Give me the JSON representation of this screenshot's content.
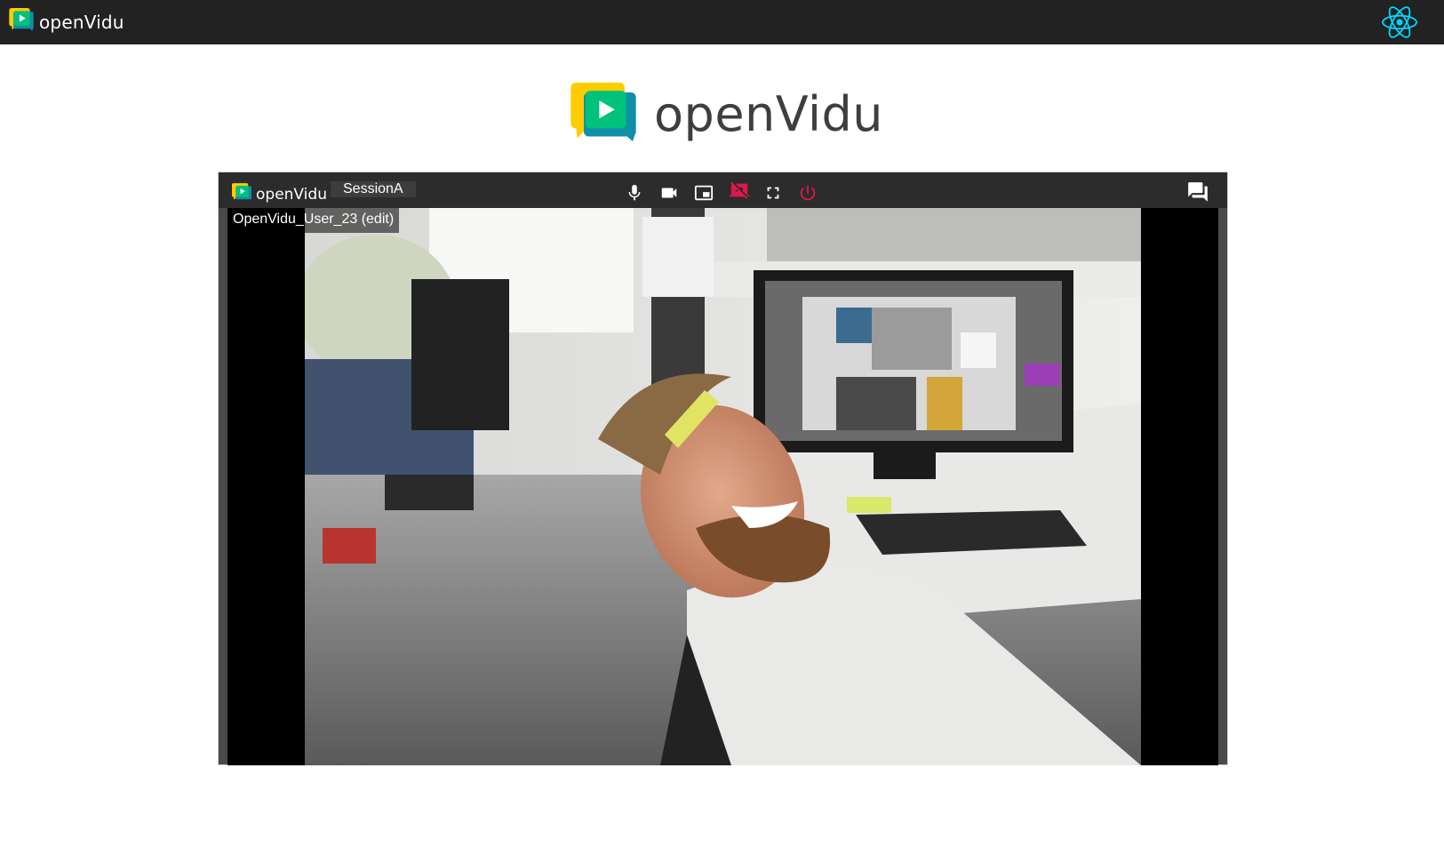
{
  "navbar": {
    "brand_text": "openVidu"
  },
  "hero": {
    "brand_text": "openVidu"
  },
  "session": {
    "toolbar_brand_text": "openVidu",
    "session_name": "SessionA",
    "nickname": "OpenVidu_User_23 (edit)",
    "controls": [
      {
        "name": "microphone",
        "icon": "mic-icon",
        "state": "on"
      },
      {
        "name": "camera",
        "icon": "videocam-icon",
        "state": "on"
      },
      {
        "name": "switch-camera",
        "icon": "picture-in-picture-icon",
        "state": "on"
      },
      {
        "name": "screen-share",
        "icon": "stop-screen-share-icon",
        "state": "off"
      },
      {
        "name": "fullscreen",
        "icon": "fullscreen-icon",
        "state": "off"
      },
      {
        "name": "leave-session",
        "icon": "power-icon",
        "state": "off"
      }
    ],
    "chat_icon": "chat-icon"
  },
  "colors": {
    "navbar_bg": "#222222",
    "toolbar_bg": "#2c2c2c",
    "logo_yellow": "#ffcc00",
    "logo_green": "#00c27a",
    "logo_teal": "#0f8fa8",
    "screen_share_red": "#e0174c",
    "leave_red": "#e0174c",
    "react_blue": "#00d8ff"
  }
}
